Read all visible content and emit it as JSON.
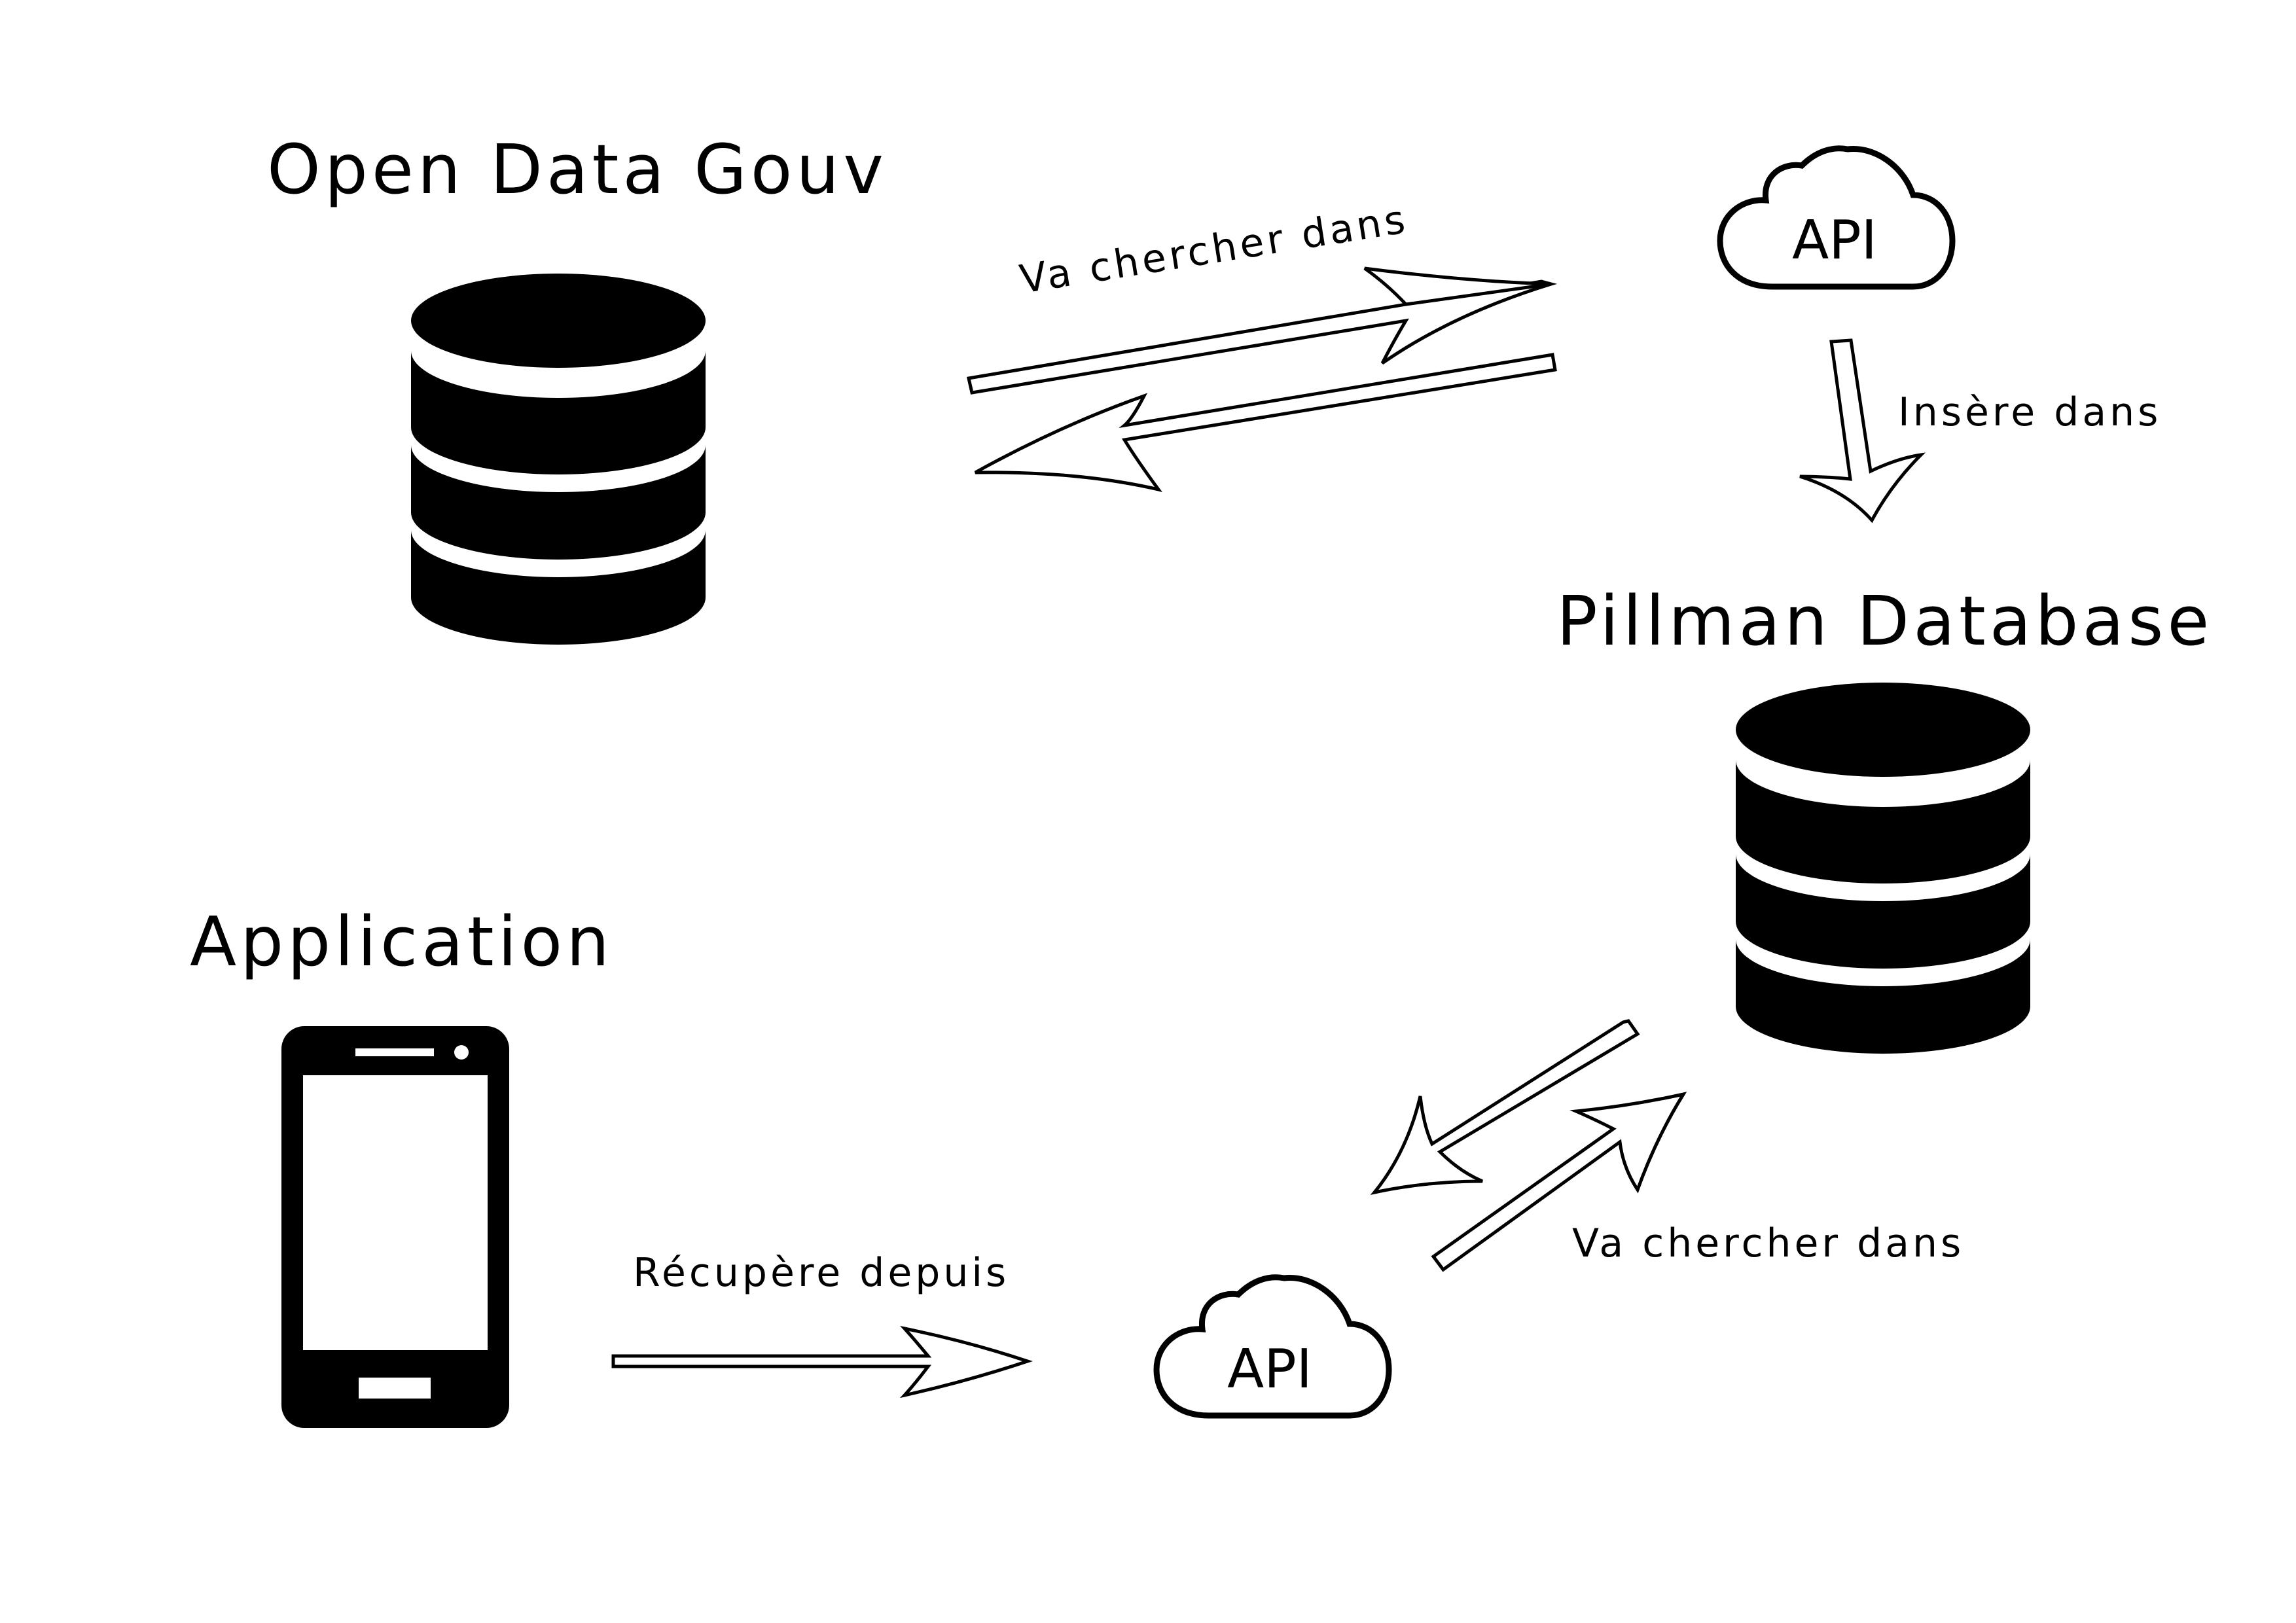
{
  "diagram": {
    "nodes": {
      "open_data_gouv": {
        "title": "Open Data Gouv",
        "icon": "database-icon"
      },
      "pillman_database": {
        "title": "Pillman Database",
        "icon": "database-icon"
      },
      "application": {
        "title": "Application",
        "icon": "smartphone-icon"
      },
      "api_top": {
        "label": "API",
        "icon": "cloud-icon"
      },
      "api_bottom": {
        "label": "API",
        "icon": "cloud-icon"
      }
    },
    "edges": [
      {
        "from": "Open Data Gouv",
        "to": "API",
        "label": "Va chercher dans"
      },
      {
        "from": "API",
        "to": "Open Data Gouv",
        "label": ""
      },
      {
        "from": "API",
        "to": "Pillman Database",
        "label": "Insère dans"
      },
      {
        "from": "Pillman Database",
        "to": "API",
        "label": ""
      },
      {
        "from": "API",
        "to": "Pillman Database",
        "label": "Va chercher dans"
      },
      {
        "from": "Application",
        "to": "API",
        "label": "Récupère depuis"
      }
    ],
    "colors": {
      "ink": "#000000",
      "background": "#ffffff"
    }
  }
}
